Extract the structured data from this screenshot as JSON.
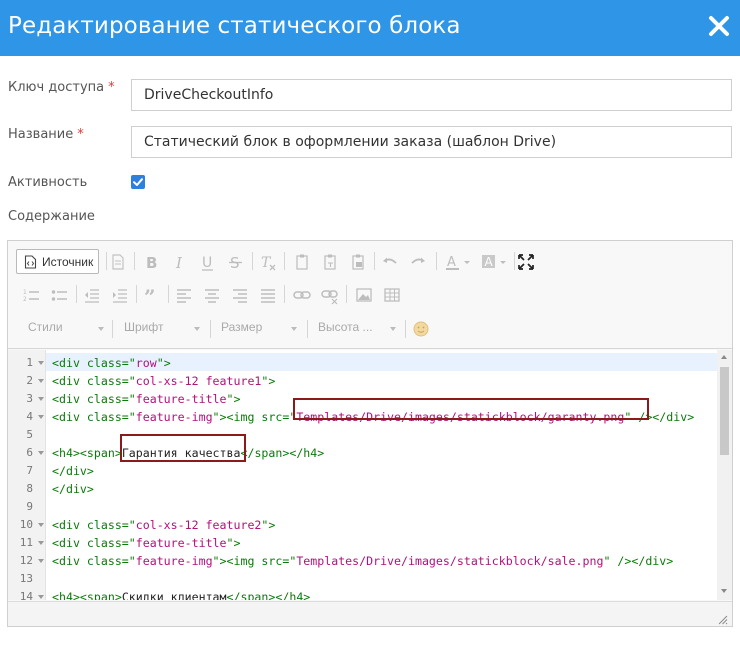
{
  "dialog": {
    "title": "Редактирование статического блока"
  },
  "form": {
    "key": {
      "label": "Ключ доступа",
      "required_mark": "*",
      "value": "DriveCheckoutInfo"
    },
    "name": {
      "label": "Название",
      "required_mark": "*",
      "value": "Статический блок в оформлении заказа (шаблон Drive)"
    },
    "active": {
      "label": "Активность",
      "checked": true
    },
    "content": {
      "label": "Содержание"
    }
  },
  "editor": {
    "source_button": "Источник",
    "combos": {
      "styles": "Стили",
      "font": "Шрифт",
      "size": "Размер",
      "height": "Высота ..."
    },
    "code_lines": [
      {
        "n": "1",
        "fold": true,
        "text": "<div class=\"row\">"
      },
      {
        "n": "2",
        "fold": true,
        "text": "<div class=\"col-xs-12 feature1\">"
      },
      {
        "n": "3",
        "fold": true,
        "text": "<div class=\"feature-title\">"
      },
      {
        "n": "4",
        "fold": true,
        "text": "<div class=\"feature-img\"><img src=\"Templates/Drive/images/statickblock/garanty.png\" /></div>"
      },
      {
        "n": "5",
        "fold": false,
        "text": ""
      },
      {
        "n": "6",
        "fold": true,
        "text": "<h4><span>Гарантия качества</span></h4>"
      },
      {
        "n": "7",
        "fold": false,
        "text": "</div>"
      },
      {
        "n": "8",
        "fold": false,
        "text": "</div>"
      },
      {
        "n": "9",
        "fold": false,
        "text": ""
      },
      {
        "n": "10",
        "fold": true,
        "text": "<div class=\"col-xs-12 feature2\">"
      },
      {
        "n": "11",
        "fold": true,
        "text": "<div class=\"feature-title\">"
      },
      {
        "n": "12",
        "fold": true,
        "text": "<div class=\"feature-img\"><img src=\"Templates/Drive/images/statickblock/sale.png\" /></div>"
      },
      {
        "n": "13",
        "fold": false,
        "text": ""
      },
      {
        "n": "14",
        "fold": true,
        "text": "<h4><span>Скидки клиентам</span></h4>"
      }
    ]
  },
  "colors": {
    "header": "#2f95e6",
    "required": "#e23b3b",
    "checkbox": "#2f7fe0",
    "highlight_box": "#8b1a1a",
    "tag": "#0b7a0b",
    "string": "#b0127a"
  }
}
